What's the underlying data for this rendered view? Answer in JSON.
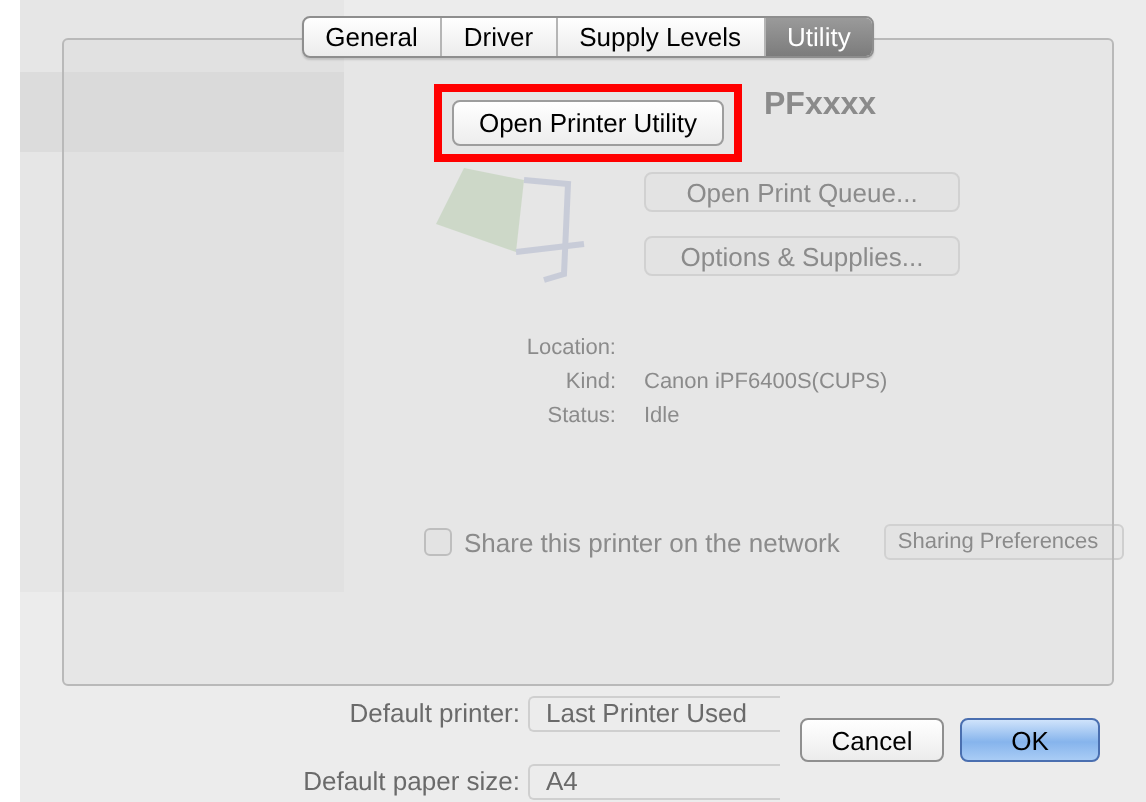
{
  "background_window": {
    "printer_name": "PFxxxx",
    "buttons": [
      "Open Print Queue...",
      "Options & Supplies..."
    ],
    "info": [
      {
        "label": "Location:"
      },
      {
        "label": "Kind:",
        "value": "Canon iPF6400S(CUPS)"
      },
      {
        "label": "Status:",
        "value": "Idle"
      }
    ],
    "share": {
      "label": "Share this printer on the network",
      "checked": false
    },
    "sharing_button": "Sharing Preferences",
    "default_printer": {
      "label": "Default printer:",
      "value": "Last Printer Used"
    },
    "default_paper_size": {
      "label": "Default paper size:",
      "value": "A4"
    }
  },
  "sheet": {
    "tabs": [
      {
        "label": "General",
        "selected": false
      },
      {
        "label": "Driver",
        "selected": false
      },
      {
        "label": "Supply Levels",
        "selected": false
      },
      {
        "label": "Utility",
        "selected": true
      }
    ],
    "utility_button": {
      "label": "Open Printer Utility",
      "highlighted": true
    },
    "buttons": [
      {
        "label": "Cancel",
        "default": false
      },
      {
        "label": "OK",
        "default": true
      }
    ]
  }
}
